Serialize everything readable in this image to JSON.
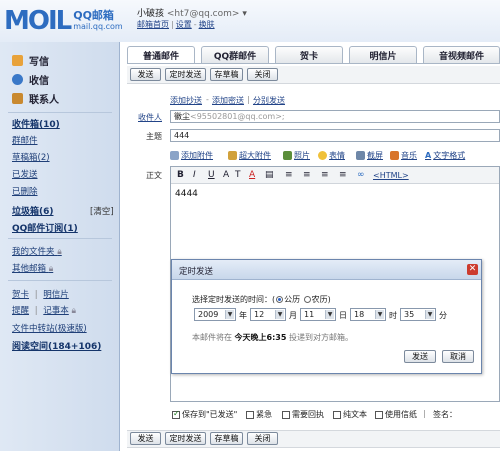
{
  "header": {
    "logo_mark": "MOIL",
    "logo_brand": "QQ邮箱",
    "logo_domain": "mail.qq.com",
    "user_name": "小破孩",
    "user_email": "<ht7@qq.com>",
    "links": [
      "邮箱首页",
      "设置",
      "换肤"
    ]
  },
  "sidebar": {
    "actions": [
      {
        "label": "写信",
        "color": "#e8a23a"
      },
      {
        "label": "收信",
        "color": "#3a78c8"
      },
      {
        "label": "联系人",
        "color": "#c9892f"
      }
    ],
    "folders": [
      {
        "label": "收件箱(10)",
        "bold": true
      },
      {
        "label": "群邮件",
        "bold": false
      },
      {
        "label": "草稿箱(2)",
        "bold": false
      },
      {
        "label": "已发送",
        "bold": false
      },
      {
        "label": "已删除",
        "bold": false
      },
      {
        "label": "垃圾箱(6)",
        "bold": true,
        "extra": "[清空]"
      },
      {
        "label": "QQ邮件订阅(1)",
        "bold": true
      }
    ],
    "my_folders": "我的文件夹",
    "other_mailbox": "其他邮箱",
    "apps": [
      "贺卡",
      "明信片",
      "提醒",
      "记事本"
    ],
    "transfer": "文件中转站(极速版)",
    "reading": "阅读空间(184+106)"
  },
  "tabs": [
    "普通邮件",
    "QQ群邮件",
    "贺卡",
    "明信片",
    "音视频邮件"
  ],
  "toolbar": {
    "send": "发送",
    "timed_send": "定时发送",
    "save_draft": "存草稿",
    "close": "关闭"
  },
  "compose": {
    "add_cc": "添加抄送",
    "add_bcc": "添加密送",
    "separate_send": "分别发送",
    "to_label": "收件人",
    "to_value": "徽尘",
    "to_hint": "<95502801@qq.com>;",
    "subject_label": "主题",
    "subject_value": "444",
    "body_label": "正文",
    "body_text": "4444",
    "attach_tools": [
      "添加附件",
      "超大附件",
      "照片",
      "表情",
      "截屏",
      "音乐",
      "文字格式"
    ],
    "format_buttons": [
      "B",
      "I",
      "U",
      "A",
      "T",
      "A",
      "≡",
      "≡",
      "≡",
      "≡",
      "∞",
      "<HTML>"
    ]
  },
  "dialog": {
    "title": "定时发送",
    "prompt": "选择定时发送的时间：(",
    "calendar_solar": "公历",
    "calendar_lunar": "农历",
    "prompt_end": ")",
    "year": "2009",
    "year_unit": "年",
    "month": "12",
    "month_unit": "月",
    "day": "11",
    "day_unit": "日",
    "hour": "18",
    "hour_unit": "时",
    "minute": "35",
    "minute_unit": "分",
    "note_prefix": "本邮件将在",
    "note_time": "今天晚上6:35",
    "note_suffix": "投递到对方邮箱。",
    "ok": "发送",
    "cancel": "取消"
  },
  "bottom_options": {
    "save_sent": "保存到\"已发送\"",
    "urgent": "紧急",
    "receipt": "需要回执",
    "plain_text": "纯文本",
    "stationery": "使用信纸",
    "signature": "签名："
  },
  "colors": {
    "link": "#224488",
    "accent": "#2d6cc0",
    "close_red": "#cc3b2e"
  }
}
